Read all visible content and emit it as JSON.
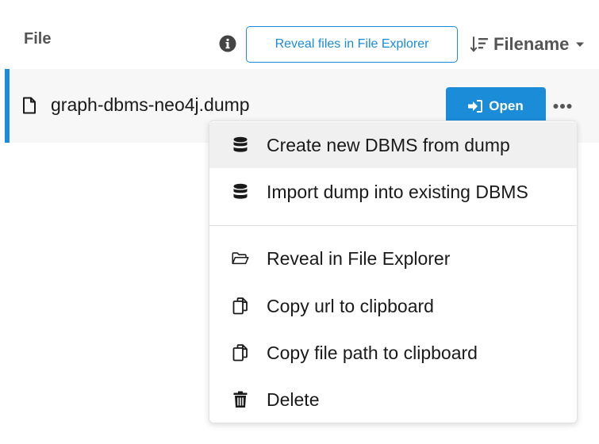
{
  "header": {
    "title": "File",
    "reveal_button_label": "Reveal files in File Explorer",
    "sort_label": "Filename"
  },
  "file": {
    "name": "graph-dbms-neo4j.dump",
    "open_label": "Open"
  },
  "menu": {
    "items": [
      {
        "label": "Create new DBMS from dump",
        "icon": "database-icon"
      },
      {
        "label": "Import dump into existing DBMS",
        "icon": "database-icon"
      },
      {
        "label": "Reveal in File Explorer",
        "icon": "folder-open-icon"
      },
      {
        "label": "Copy url to clipboard",
        "icon": "copy-icon"
      },
      {
        "label": "Copy file path to clipboard",
        "icon": "copy-icon"
      },
      {
        "label": "Delete",
        "icon": "trash-icon"
      }
    ]
  },
  "colors": {
    "accent": "#1a8cd8",
    "row_background": "#f7f7f7",
    "hover_background": "#f0f0f0"
  }
}
